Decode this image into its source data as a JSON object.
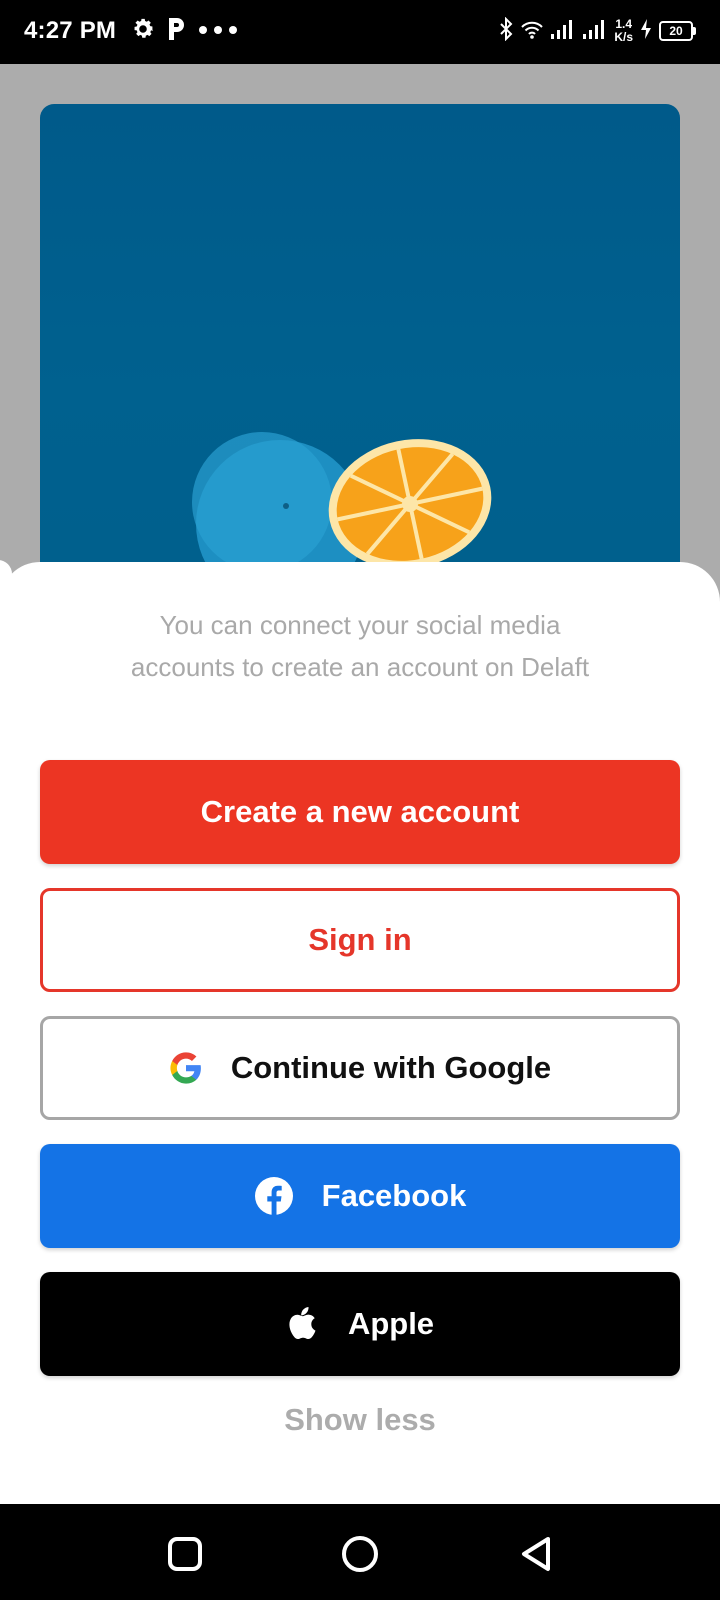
{
  "status_bar": {
    "time": "4:27 PM",
    "left_icons": [
      "gear-icon",
      "p-app-icon",
      "more-dots-icon"
    ],
    "right_icons": [
      "bluetooth-icon",
      "wifi-icon",
      "signal-icon",
      "signal-icon",
      "charging-icon"
    ],
    "net_speed_value": "1.4",
    "net_speed_unit": "K/s",
    "battery_level": "20"
  },
  "hero": {
    "background_color": "#005a8a",
    "icons": [
      "orange-fruit-image"
    ]
  },
  "sheet": {
    "description": "You can connect your social media accounts to create an account on Delaft",
    "buttons": {
      "create_label": "Create a new account",
      "signin_label": "Sign in",
      "google_label": "Continue with Google",
      "facebook_label": "Facebook",
      "apple_label": "Apple"
    },
    "show_less": "Show less"
  },
  "colors": {
    "create_button": "#ec3523",
    "signin_border": "#e5362a",
    "google_border": "#a6a6a6",
    "facebook_button": "#1473e6",
    "apple_button": "#000000",
    "description_text": "#a9a9a9"
  },
  "nav_bar": {
    "icons": [
      "recents-square-icon",
      "home-circle-icon",
      "back-triangle-icon"
    ]
  }
}
